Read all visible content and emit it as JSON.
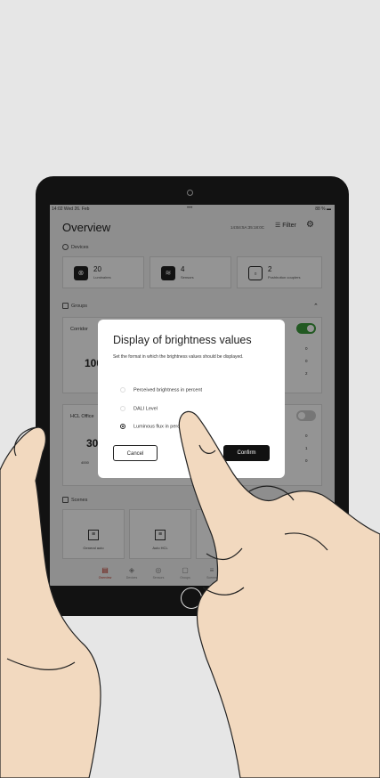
{
  "status_bar": {
    "time_date": "14:02 Wed 26. Feb",
    "battery": "88 %"
  },
  "header": {
    "title": "Overview",
    "serial": "14:B4:5A:35:18:0C",
    "filter_label": "Filter"
  },
  "devices": {
    "section_label": "Devices",
    "cards": [
      {
        "count": "20",
        "label": "Luminaires",
        "icon": "luminaire-icon"
      },
      {
        "count": "4",
        "label": "Sensors",
        "icon": "sensor-icon"
      },
      {
        "count": "2",
        "label": "Pushbutton couplers",
        "icon": "pushbutton-icon"
      }
    ]
  },
  "groups": {
    "section_label": "Groups",
    "items": [
      {
        "name": "Corridor",
        "value": "100",
        "toggle": "on",
        "right_values": [
          "0",
          "0",
          "2"
        ]
      },
      {
        "name": "HCL Office",
        "value": "30",
        "sub": "4000",
        "toggle": "off",
        "right_values": [
          "0",
          "1",
          "0"
        ]
      }
    ]
  },
  "scenes": {
    "section_label": "Scenes",
    "items": [
      {
        "label": "General auto"
      },
      {
        "label": "Auto HCL"
      },
      {
        "label": "Au"
      }
    ]
  },
  "tabbar": [
    "Overview",
    "Devices",
    "Sensors",
    "Groups",
    "Scenes"
  ],
  "dialog": {
    "title": "Display of brightness values",
    "description": "Set the format in which the brightness values should be displayed.",
    "options": [
      {
        "label": "Perceived brightness in percent",
        "selected": false
      },
      {
        "label": "DALI Level",
        "selected": false
      },
      {
        "label": "Luminous flux in percent",
        "selected": true
      }
    ],
    "cancel_label": "Cancel",
    "confirm_label": "Confirm"
  },
  "colors": {
    "accent": "#3c9a3c",
    "active_tab": "#c0392b",
    "skin": "#f2d9bf"
  }
}
